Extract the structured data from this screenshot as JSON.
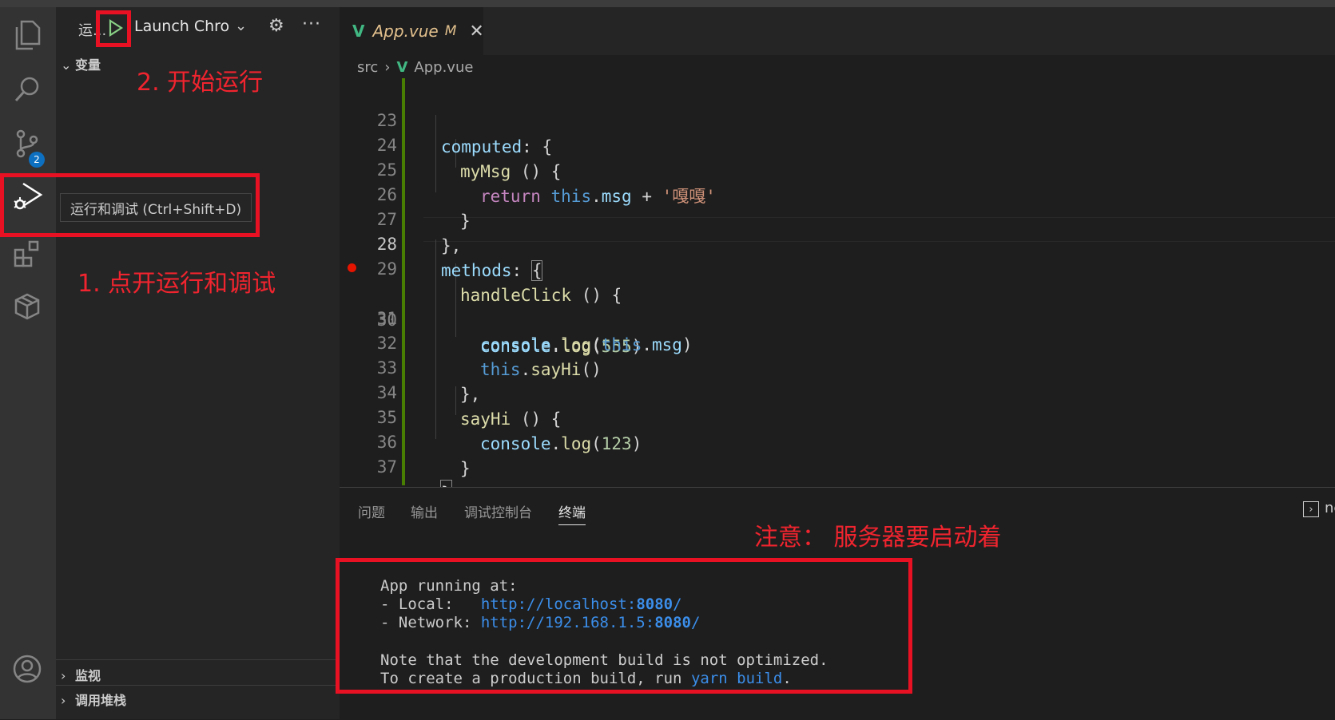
{
  "activity_bar": {
    "scm_badge": "2"
  },
  "sidebar": {
    "run_label": "运...",
    "launch_config": "Launch Chrome",
    "sections": {
      "variables": "变量",
      "watch": "监视",
      "call_stack": "调用堆栈"
    },
    "tooltip": "运行和调试 (Ctrl+Shift+D)"
  },
  "annotations": {
    "step1": "1. 点开运行和调试",
    "step2": "2. 开始运行",
    "note": "注意： 服务器要启动着"
  },
  "editor": {
    "tab": {
      "name": "App.vue",
      "modified": "M",
      "logo": "V"
    },
    "breadcrumb": {
      "folder": "src",
      "file": "App.vue"
    },
    "lines": [
      {
        "num": "23",
        "code": "computed: {"
      },
      {
        "num": "24",
        "code": "myMsg () {"
      },
      {
        "num": "25",
        "code": "return this.msg + '嘎嘎'"
      },
      {
        "num": "26",
        "code": "}"
      },
      {
        "num": "27",
        "code": "},"
      },
      {
        "num": "28",
        "code": "methods: {"
      },
      {
        "num": "29",
        "code": "handleClick () {"
      },
      {
        "num": "30",
        "code": "console.log(555)"
      },
      {
        "num": "31",
        "code": "console.log(this.msg)"
      },
      {
        "num": "32",
        "code": "this.sayHi()"
      },
      {
        "num": "33",
        "code": "},"
      },
      {
        "num": "34",
        "code": "sayHi () {"
      },
      {
        "num": "35",
        "code": "console.log(123)"
      },
      {
        "num": "36",
        "code": "}"
      },
      {
        "num": "37",
        "code": "}"
      }
    ]
  },
  "panel": {
    "tabs": [
      "问题",
      "输出",
      "调试控制台",
      "终端"
    ],
    "terminal_label": "nc",
    "terminal": {
      "l1": "App running at:",
      "l2_prefix": "- Local:   ",
      "l2_url_a": "http://localhost:",
      "l2_port": "8080",
      "l2_url_b": "/",
      "l3_prefix": "- Network: ",
      "l3_url_a": "http://192.168.1.5:",
      "l3_port": "8080",
      "l3_url_b": "/",
      "l4": "Note that the development build is not optimized.",
      "l5_prefix": "To create a production build, run ",
      "l5_cmd": "yarn build",
      "l5_suffix": "."
    }
  },
  "colors": {
    "annotation_red": "#e81123",
    "vue_green": "#41b883",
    "link_blue": "#3b8eea"
  }
}
